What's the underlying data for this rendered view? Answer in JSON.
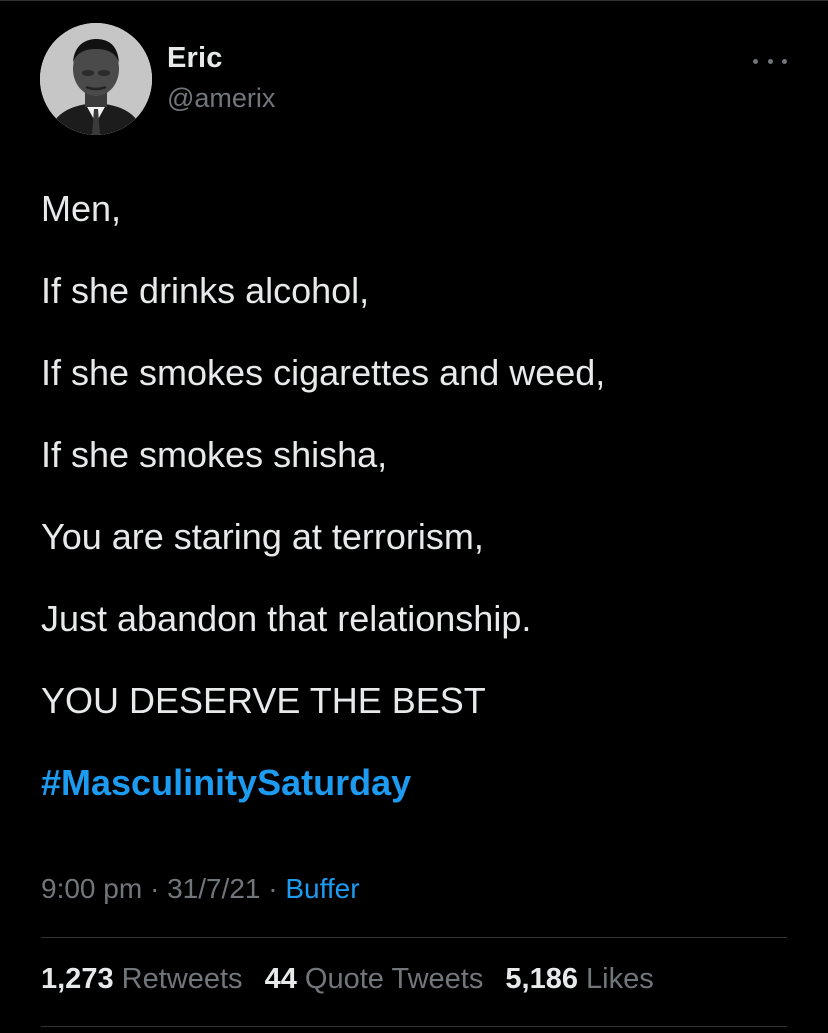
{
  "author": {
    "name": "Eric",
    "handle": "@amerix",
    "avatar": "profile-photo"
  },
  "menu_icon": "more-horizontal-icon",
  "tweet": {
    "lines": [
      "Men,",
      "If she drinks alcohol,",
      "If she smokes cigarettes and weed,",
      "If she smokes shisha,",
      "You are staring at terrorism,",
      "Just abandon that relationship.",
      "YOU DESERVE THE BEST"
    ],
    "hashtag": "#MasculinitySaturday"
  },
  "meta": {
    "time": "9:00 pm",
    "separator": " · ",
    "date": "31/7/21",
    "source": "Buffer"
  },
  "stats": {
    "retweets": {
      "count": "1,273",
      "label": "Retweets"
    },
    "quote_tweets": {
      "count": "44",
      "label": "Quote Tweets"
    },
    "likes": {
      "count": "5,186",
      "label": "Likes"
    }
  },
  "colors": {
    "background": "#000000",
    "text": "#e7e9ea",
    "secondary": "#71767b",
    "accent": "#1d9bf0",
    "divider": "#2f3336"
  }
}
